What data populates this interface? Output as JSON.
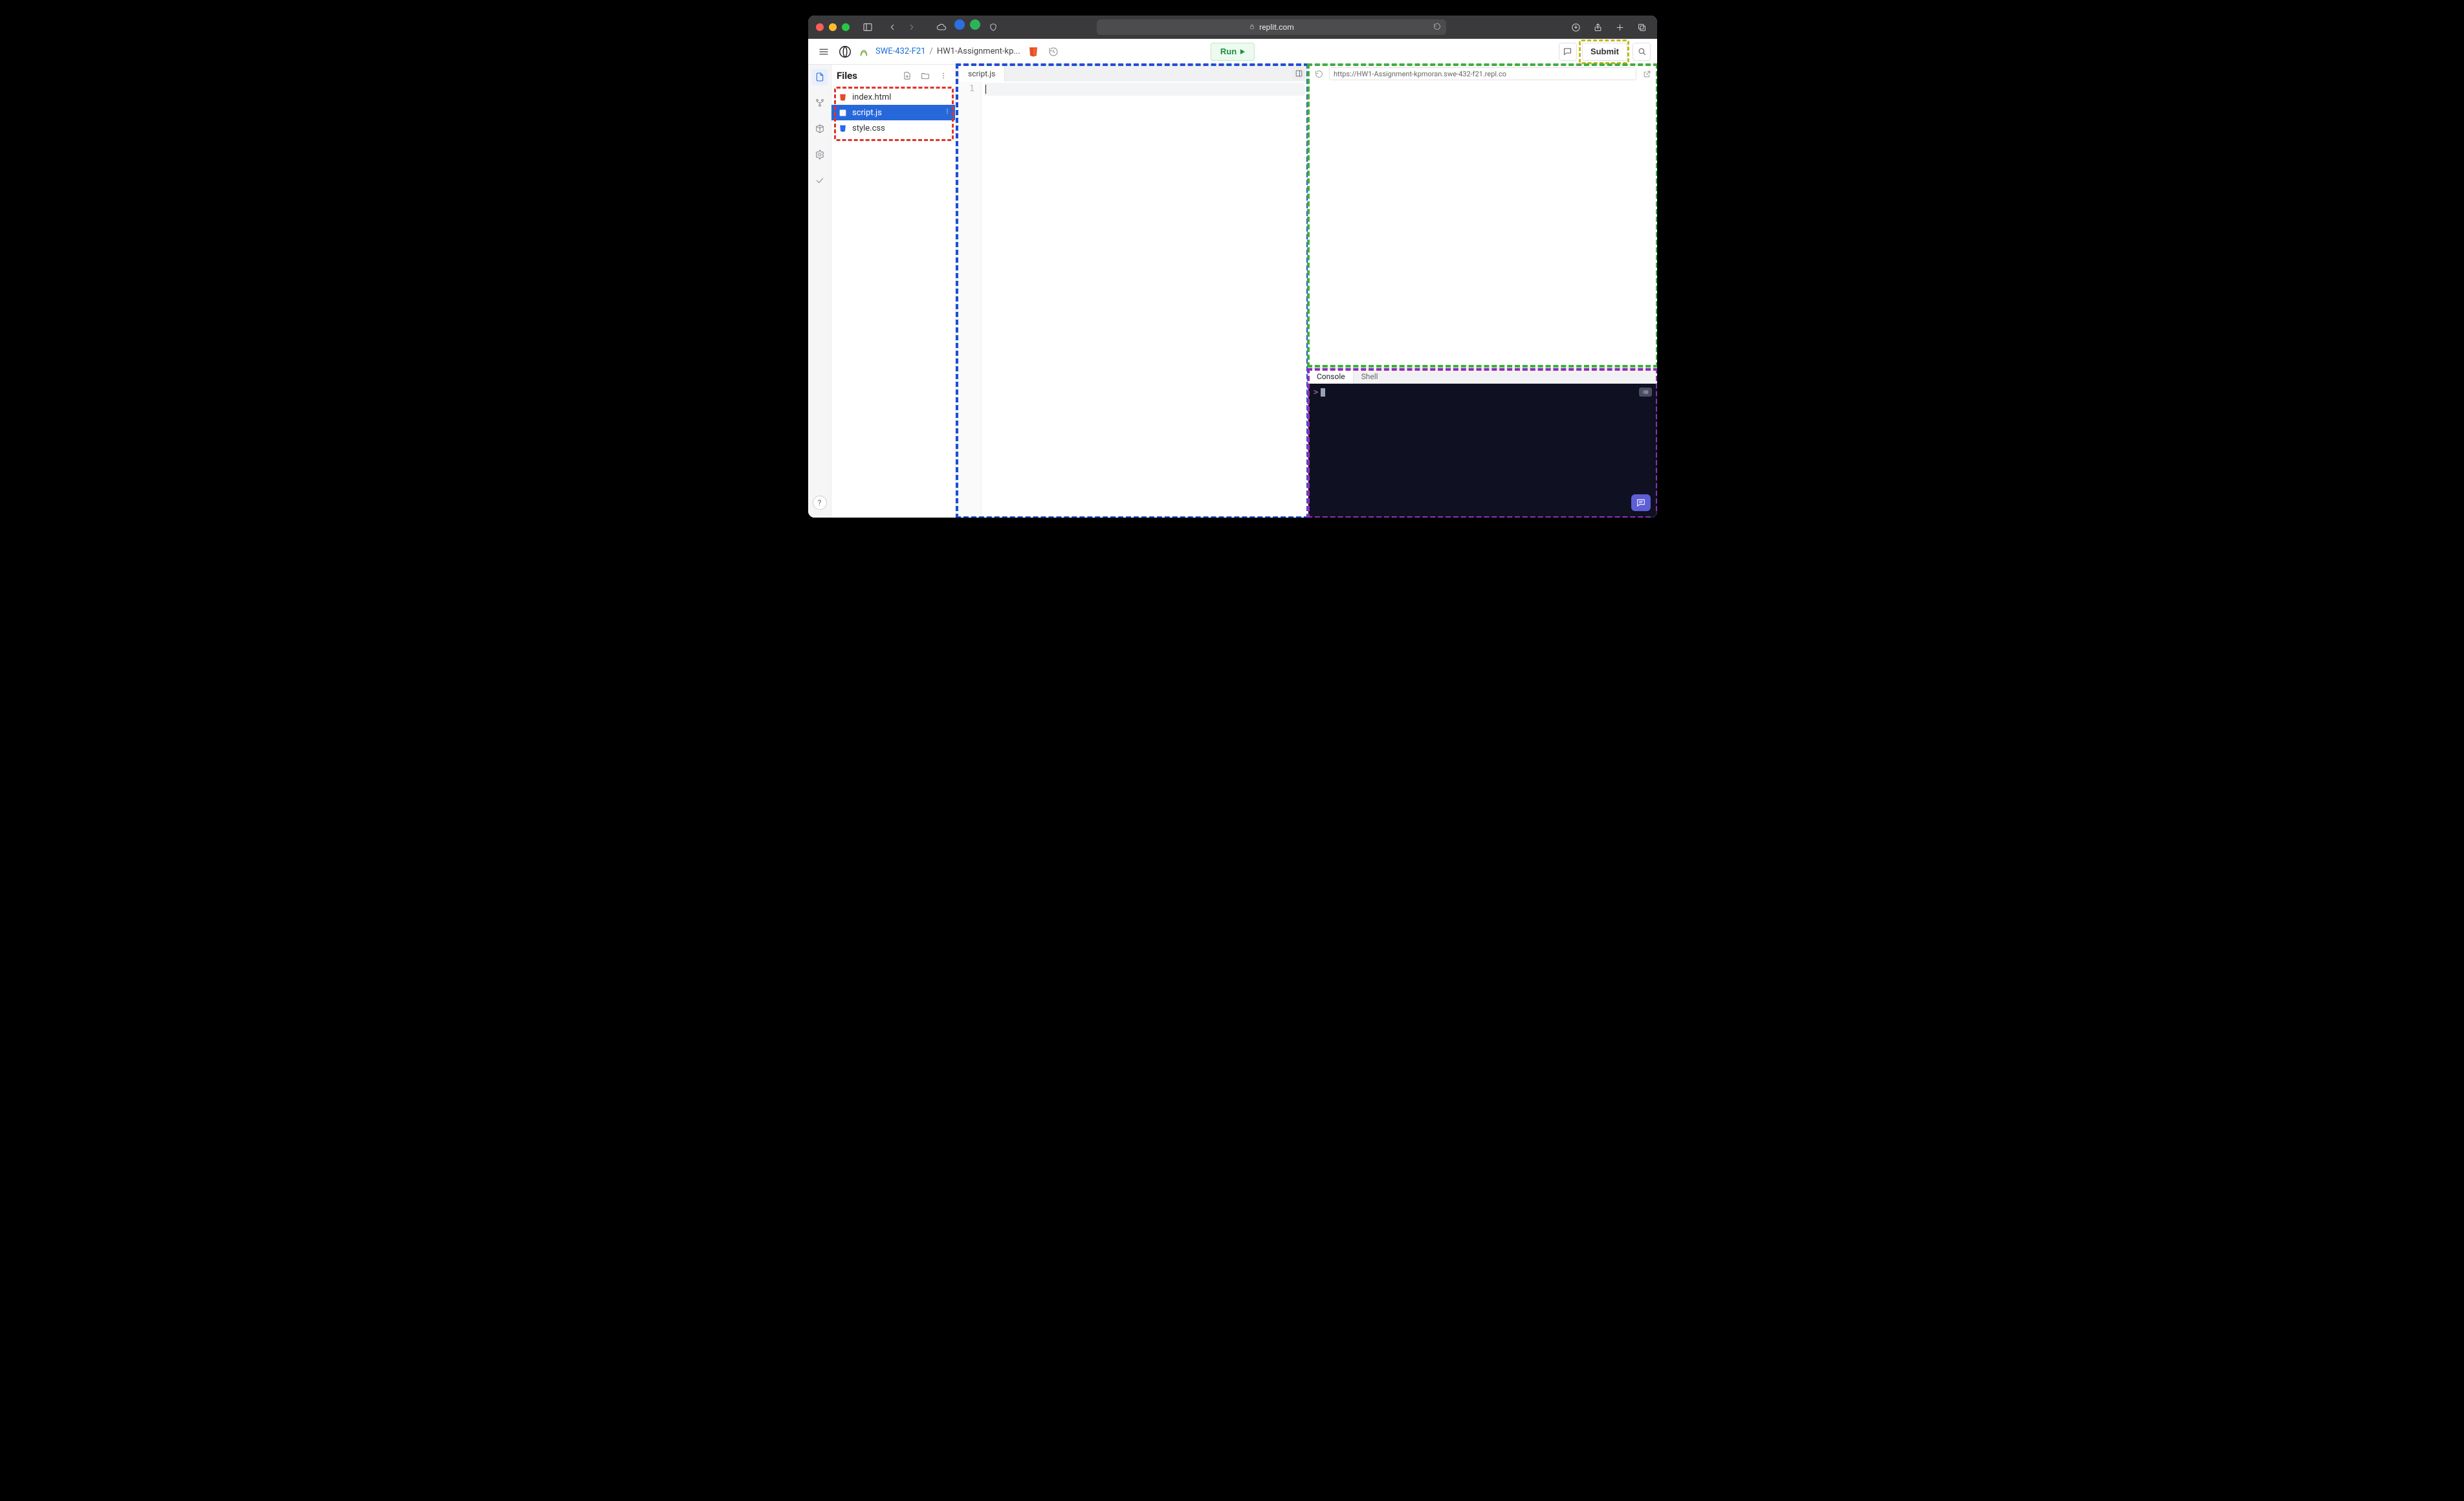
{
  "browser": {
    "url_host": "replit.com",
    "lock_label": "secure"
  },
  "header": {
    "team": "SWE-432-F21",
    "project_truncated": "HW1-Assignment-kp...",
    "run_label": "Run",
    "submit_label": "Submit"
  },
  "rail": {
    "files_tooltip": "Files",
    "vcs_tooltip": "Version control",
    "packages_tooltip": "Packages",
    "settings_tooltip": "Settings",
    "checks_tooltip": "Tests",
    "help_label": "?"
  },
  "files_panel": {
    "title": "Files",
    "items": [
      {
        "name": "index.html",
        "type": "html",
        "selected": false
      },
      {
        "name": "script.js",
        "type": "js",
        "selected": true
      },
      {
        "name": "style.css",
        "type": "css",
        "selected": false
      }
    ]
  },
  "editor": {
    "tab_label": "script.js",
    "gutter_first_line": "1"
  },
  "preview": {
    "address": "https://HW1-Assignment-kpmoran.swe-432-f21.repl.co"
  },
  "console": {
    "tabs": [
      {
        "label": "Console",
        "active": true
      },
      {
        "label": "Shell",
        "active": false
      }
    ],
    "prompt": ">"
  }
}
